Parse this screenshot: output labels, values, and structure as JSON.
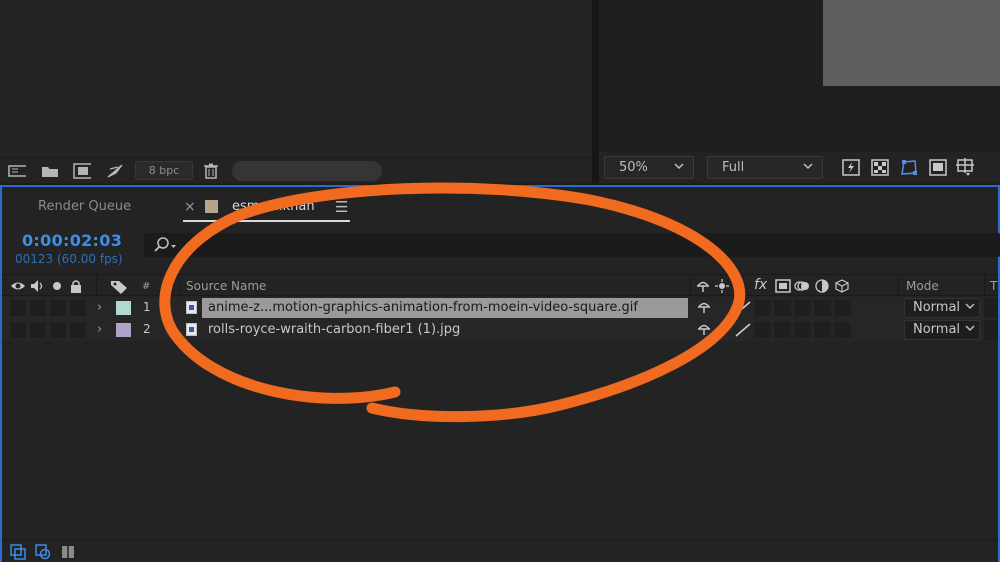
{
  "project_panel": {
    "bpc_label": "8 bpc",
    "footer_icons": [
      "interpret-footage-icon",
      "new-folder-icon",
      "new-composition-icon",
      "adjust-project-settings-icon"
    ]
  },
  "viewer": {
    "zoom": "50%",
    "resolution": "Full",
    "footer_icons": [
      "fast-previews-icon",
      "transparency-grid-icon",
      "mask-visibility-icon",
      "region-of-interest-icon",
      "guides-icon"
    ]
  },
  "timeline": {
    "tabs": [
      {
        "label": "Render Queue"
      },
      {
        "label": "esmaeilkhah",
        "active": true
      }
    ],
    "timecode": "0:00:02:03",
    "frame_info": "00123 (60.00 fps)",
    "columns": {
      "hash": "#",
      "source_name": "Source Name",
      "mode": "Mode",
      "t": "T",
      "fx": "fx"
    },
    "layers": [
      {
        "num": "1",
        "name": "anime-z...motion-graphics-animation-from-moein-video-square.gif",
        "label_color": "#b3d8cf",
        "mode": "Normal",
        "selected": true
      },
      {
        "num": "2",
        "name": "rolls-royce-wraith-carbon-fiber1 (1).jpg",
        "label_color": "#aea4c8",
        "mode": "Normal",
        "selected": false
      }
    ]
  },
  "colors": {
    "accent_blue": "#2d6ad0",
    "timecode_blue": "#3d8ee6",
    "annotation_orange": "#f06a1f"
  }
}
